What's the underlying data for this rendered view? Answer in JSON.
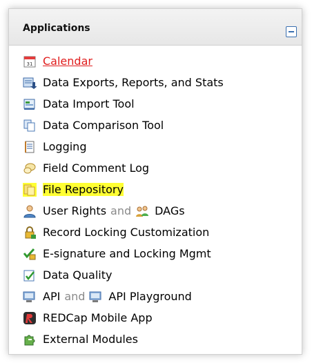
{
  "panel": {
    "title": "Applications",
    "collapse_icon": "minus-square-icon"
  },
  "items": [
    {
      "label": "Calendar",
      "icon": "calendar-icon",
      "state": "active"
    },
    {
      "label": "Data Exports, Reports, and Stats",
      "icon": "export-icon"
    },
    {
      "label": "Data Import Tool",
      "icon": "import-icon"
    },
    {
      "label": "Data Comparison Tool",
      "icon": "compare-icon"
    },
    {
      "label": "Logging",
      "icon": "log-icon"
    },
    {
      "label": "Field Comment Log",
      "icon": "comment-icon"
    },
    {
      "label": "File Repository",
      "icon": "folder-icon",
      "state": "highlighted"
    },
    {
      "label": "User Rights",
      "conjunction": "and",
      "label2": "DAGs",
      "icon": "user-icon",
      "icon2": "group-icon"
    },
    {
      "label": "Record Locking Customization",
      "icon": "lock-icon"
    },
    {
      "label": "E-signature and Locking Mgmt",
      "icon": "signature-icon"
    },
    {
      "label": "Data Quality",
      "icon": "quality-icon"
    },
    {
      "label": "API",
      "conjunction": "and",
      "label2": "API Playground",
      "icon": "api-icon",
      "icon2": "api-icon"
    },
    {
      "label": "REDCap Mobile App",
      "icon": "redcap-icon"
    },
    {
      "label": "External Modules",
      "icon": "puzzle-icon"
    }
  ],
  "colors": {
    "active_link": "#e01c1c",
    "highlight": "#ffff33",
    "conjunction": "#8a8a8a"
  }
}
